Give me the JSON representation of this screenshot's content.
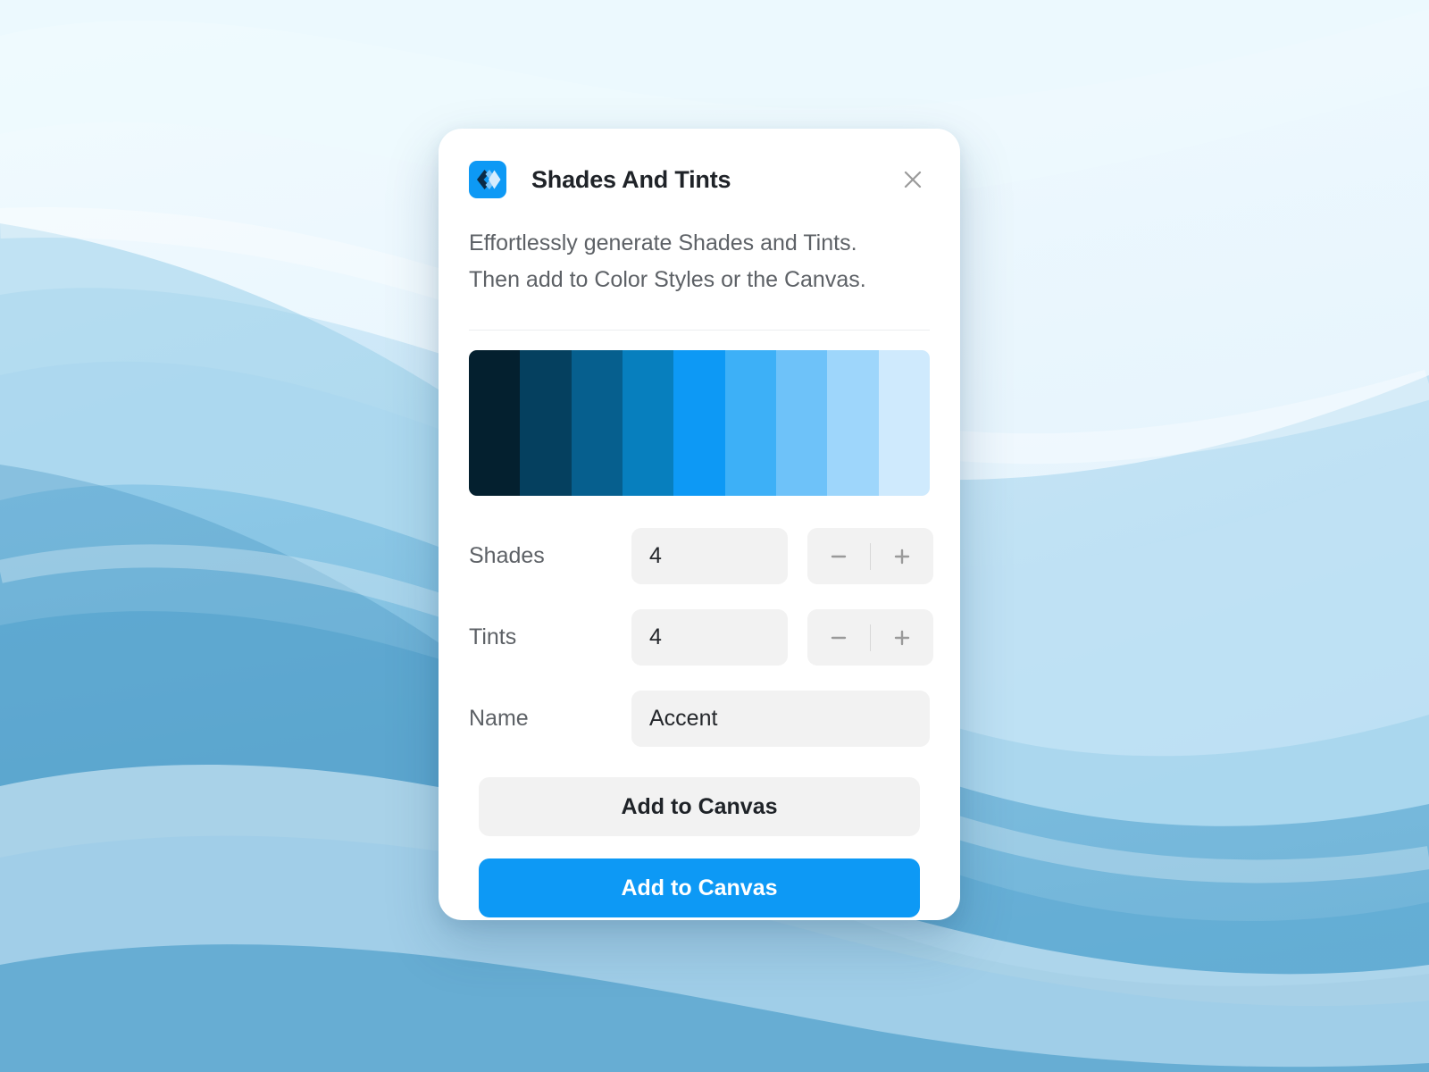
{
  "dialog": {
    "title": "Shades And Tints",
    "icon_name": "shades-and-tints-logo",
    "close_label": "×",
    "description": "Effortlessly generate Shades and Tints.\nThen add to Color Styles or the Canvas.",
    "accent_color": "#0d99f5"
  },
  "palette": {
    "swatches": [
      {
        "index": 1,
        "role": "shade",
        "hex": "#04202f"
      },
      {
        "index": 2,
        "role": "shade",
        "hex": "#05405f"
      },
      {
        "index": 3,
        "role": "shade",
        "hex": "#065f8e"
      },
      {
        "index": 4,
        "role": "shade",
        "hex": "#077fbe"
      },
      {
        "index": 5,
        "role": "base",
        "hex": "#0d99f5"
      },
      {
        "index": 6,
        "role": "tint",
        "hex": "#3db0f7"
      },
      {
        "index": 7,
        "role": "tint",
        "hex": "#6ec2f9"
      },
      {
        "index": 8,
        "role": "tint",
        "hex": "#9ed6fb"
      },
      {
        "index": 9,
        "role": "tint",
        "hex": "#cfeafd"
      }
    ]
  },
  "controls": {
    "shades": {
      "label": "Shades",
      "value": "4",
      "decrement_label": "−",
      "increment_label": "+"
    },
    "tints": {
      "label": "Tints",
      "value": "4",
      "decrement_label": "−",
      "increment_label": "+"
    },
    "name": {
      "label": "Name",
      "value": "Accent",
      "placeholder": "Accent"
    }
  },
  "actions": {
    "secondary_label": "Add to Canvas",
    "primary_label": "Add to Canvas"
  },
  "background": {
    "type": "abstract-blue-waves",
    "base_top": "#eaf6fd",
    "base_bottom": "#6db6de"
  }
}
